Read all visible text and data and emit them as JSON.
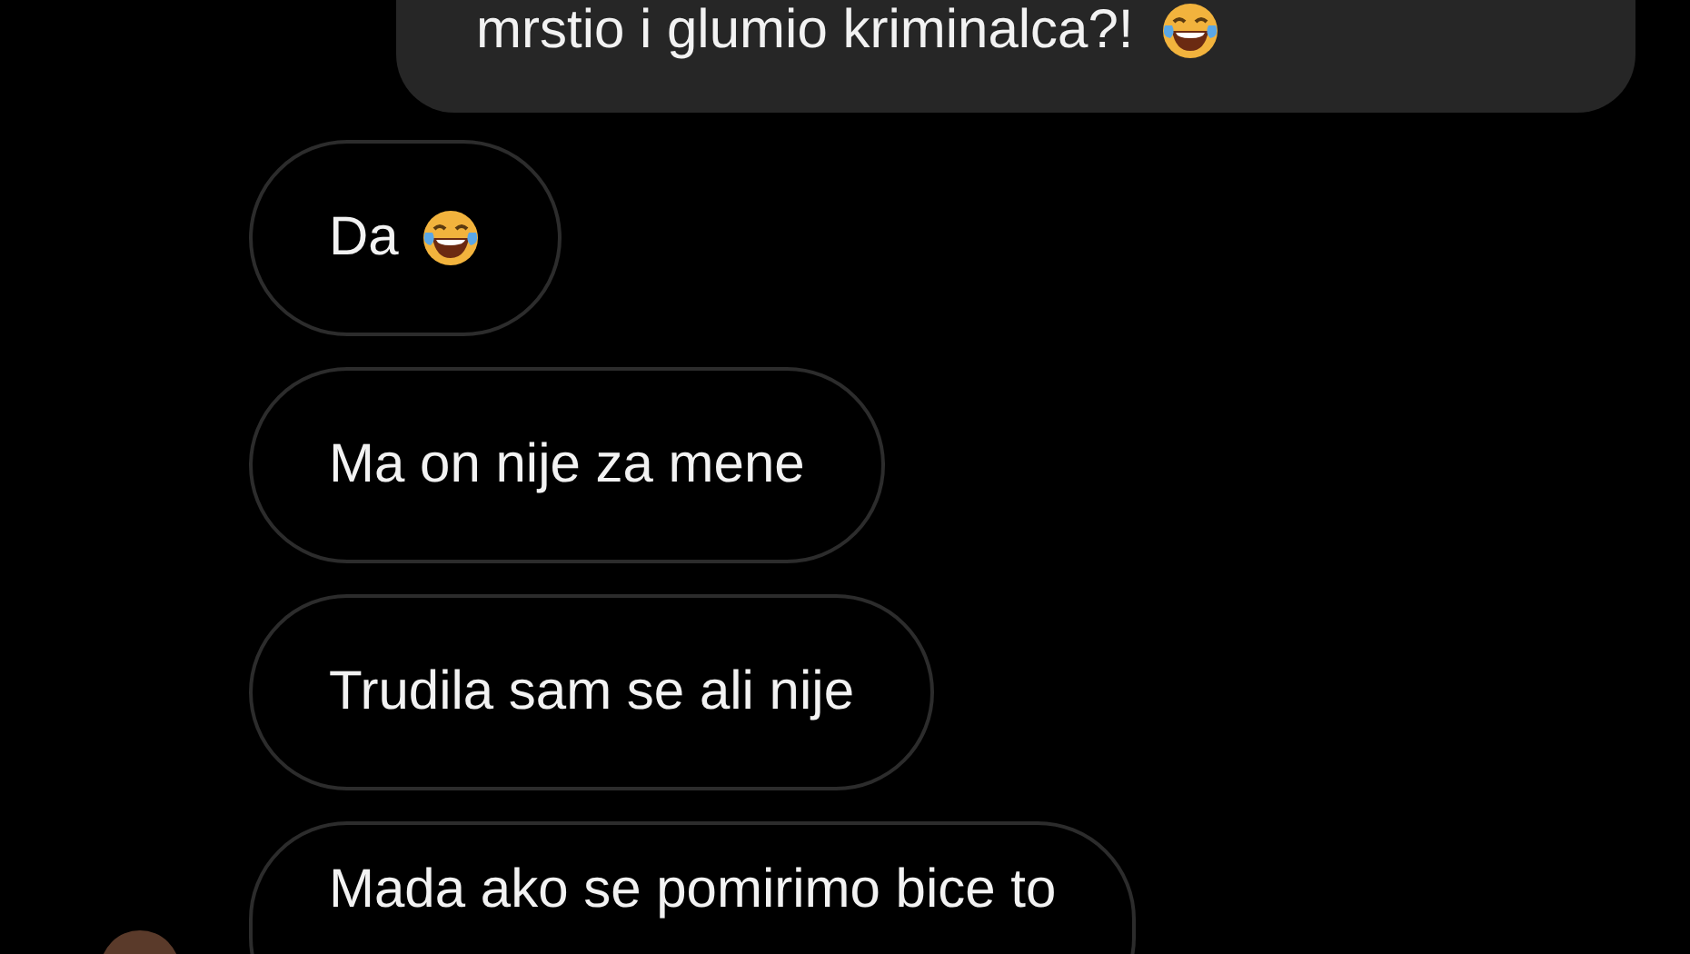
{
  "messages": [
    {
      "kind": "sent",
      "text": "mrstio i glumio kriminalca?!",
      "emoji": true
    },
    {
      "kind": "received",
      "text": "Da",
      "emoji": true
    },
    {
      "kind": "received",
      "text": "Ma on nije za mene",
      "emoji": false
    },
    {
      "kind": "received",
      "text": "Trudila sam se ali nije",
      "emoji": false
    },
    {
      "kind": "received",
      "text": "Mada ako se pomirimo bice to",
      "emoji": false,
      "avatar": true
    }
  ]
}
